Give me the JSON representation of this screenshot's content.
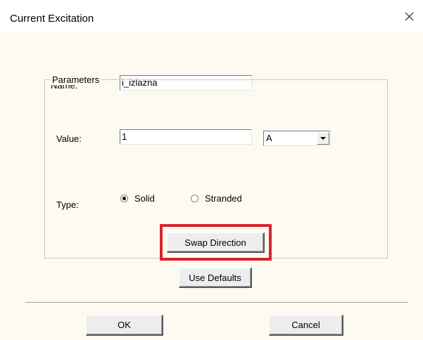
{
  "dialog": {
    "title": "Current Excitation",
    "name_label": "Name:",
    "name_value": "i_izlazna",
    "parameters_group": "Parameters",
    "value_label": "Value:",
    "value_input": "1",
    "unit_selected": "A",
    "type_label": "Type:",
    "type_options": [
      {
        "label": "Solid",
        "checked": true
      },
      {
        "label": "Stranded",
        "checked": false
      }
    ],
    "swap_direction_label": "Swap Direction",
    "use_defaults_label": "Use Defaults",
    "ok_label": "OK",
    "cancel_label": "Cancel"
  },
  "colors": {
    "highlight": "#d9232d",
    "client_background": "#fdfaf1"
  },
  "icons": {
    "close": "close-icon",
    "dropdown": "chevron-down-icon"
  }
}
